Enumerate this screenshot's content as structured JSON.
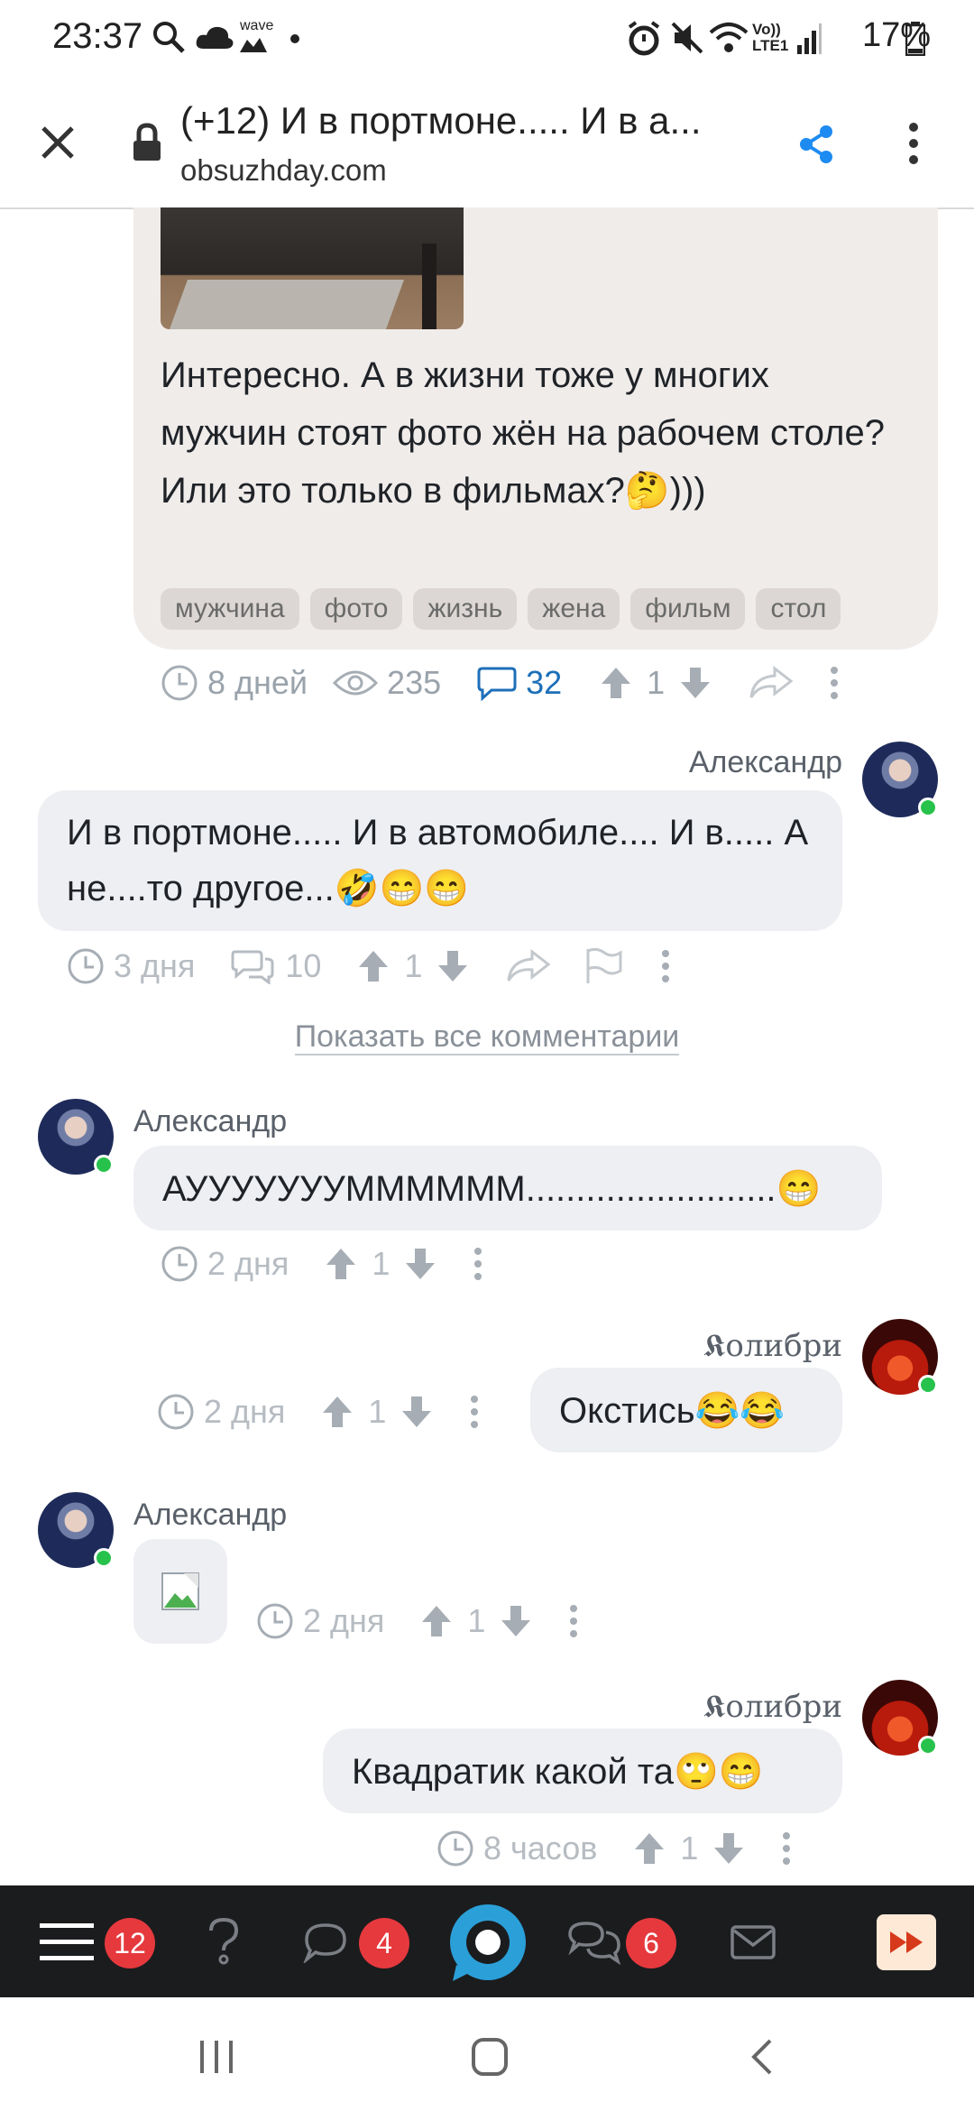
{
  "status_bar": {
    "time": "23:37",
    "battery": "17%",
    "net_label": "Vo)) LTE1",
    "wave_label": "wave"
  },
  "browser": {
    "title": "(+12) И в портмоне..... И в а...",
    "url": "obsuzhday.com"
  },
  "post": {
    "text": "Интересно. А в жизни тоже у многих мужчин стоят фото жён на рабочем столе? Или это только в фильмах?🤔)))",
    "tags": [
      "мужчина",
      "фото",
      "жизнь",
      "жена",
      "фильм",
      "стол"
    ],
    "meta": {
      "age": "8 дней",
      "views": "235",
      "comments": "32",
      "votes": "1"
    }
  },
  "comments": [
    {
      "author": "Александр",
      "text": "И в портмоне..... И в автомобиле.... И в..... А не....то другое...🤣😁😁",
      "age": "3 дня",
      "replies": "10",
      "votes": "1"
    },
    {
      "author": "Александр",
      "text": "АУУУУУУУММММММ.........................😁",
      "age": "2 дня",
      "votes": "1"
    },
    {
      "author": "𝕶олибри",
      "text": "Окстись😂😂",
      "age": "2 дня",
      "votes": "1"
    },
    {
      "author": "Александр",
      "text": "",
      "age": "2 дня",
      "votes": "1"
    },
    {
      "author": "𝕶олибри",
      "text": "Квадратик какой та🙄😁",
      "age": "8 часов",
      "votes": "1"
    }
  ],
  "show_all_label": "Показать все комментарии",
  "bottom_bar": {
    "menu_badge": "12",
    "messages_badge": "4",
    "discussions_badge": "6"
  },
  "colors": {
    "accent": "#1d8bf1",
    "bottom_bar": "#1b1c1e",
    "badge": "#e6393e",
    "bubble": "#eeeff2",
    "card": "#f0ecea"
  }
}
